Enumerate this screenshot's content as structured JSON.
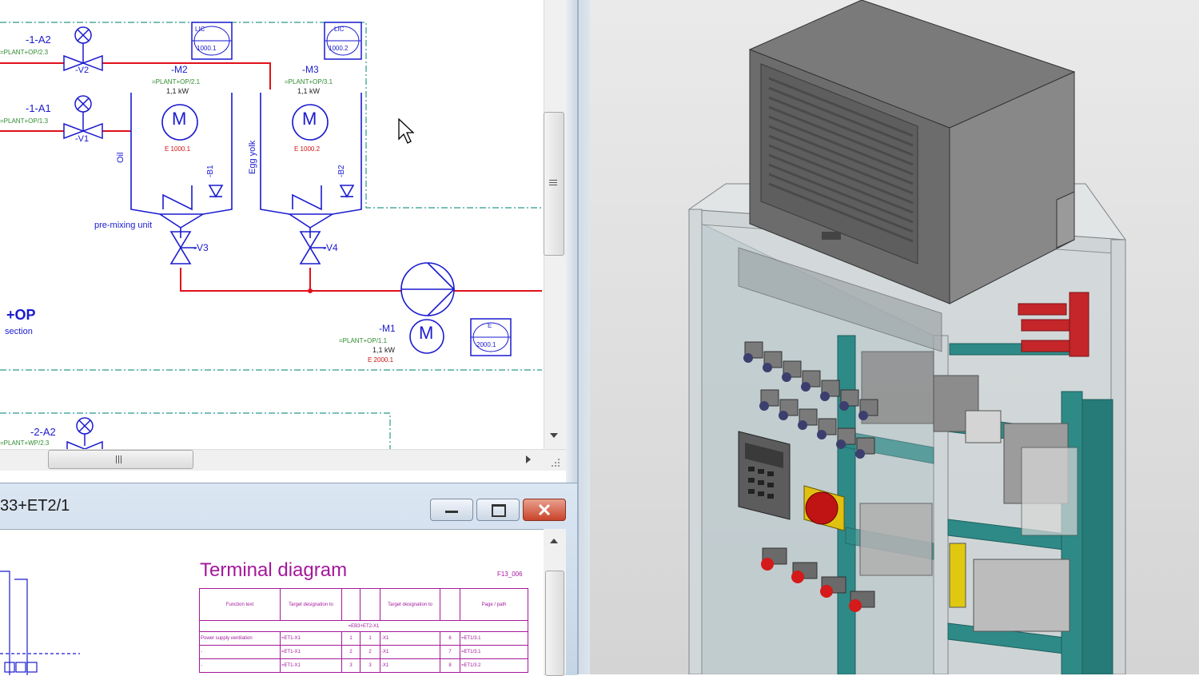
{
  "schematic": {
    "tags": {
      "valve_a2": "-1-A2",
      "valve_a1": "-1-A1",
      "valve_v2": "-V2",
      "valve_v1": "-V1",
      "motor_m2": "-M2",
      "motor_m3": "-M3",
      "valve_v3": "-V3",
      "valve_v4": "-V4",
      "pump_m1": "-M1",
      "valve_2a2": "-2-A2",
      "sensor_b1": "-B1",
      "sensor_b2": "-B2"
    },
    "refs": {
      "a2_ref": "=PLANT+OP/2.3",
      "a1_ref": "=PLANT+OP/1.3",
      "m2_ref": "=PLANT+OP/2.1",
      "m3_ref": "=PLANT+OP/3.1",
      "m1_ref": "=PLANT+OP/1.1",
      "a2b_ref": "=PLANT+WP/2.3"
    },
    "power_m2": "1,1 kW",
    "power_m3": "1,1 kW",
    "power_m1": "1,1 kW",
    "motor_symbol": "M",
    "page_m2": "E 1000.1",
    "page_m3": "E 1000.2",
    "page_m1": "E 2000.1",
    "box_lic1": "LIC",
    "box_lic1_val": "1000.1",
    "box_lic2": "LIC",
    "box_lic2_val": "1000.2",
    "box_e": "E",
    "box_e_val": "2000.1",
    "tank_oil": "Oil",
    "tank_egg": "Egg yolk",
    "pre_mixing": "pre-mixing unit",
    "location": "+OP",
    "location_sub": "section"
  },
  "terminal_window": {
    "title": "33+ET2/1",
    "diagram_title": "Terminal diagram",
    "diagram_ref": "F13_006",
    "headers": [
      "Function text",
      "Target designation to",
      "",
      "",
      "Target designation to",
      "",
      "Page / path"
    ],
    "group_label": "=EB3+ET2-X1",
    "rows": [
      [
        "Power supply ventilation",
        "=ET1-X1",
        "1",
        "1",
        "-X1",
        "6",
        "=ET1/3.1"
      ],
      [
        "-",
        "=ET1-X1",
        "2",
        "2",
        "-X1",
        "7",
        "=ET1/3.1"
      ],
      [
        "-",
        "=ET1-X1",
        "3",
        "3",
        "-X1",
        "8",
        "=ET1/3.2"
      ]
    ]
  },
  "colors": {
    "schematic_blue": "#1a1ad0",
    "pipe_red": "#e0101a",
    "ref_green": "#2e8b2e",
    "terminal_magenta": "#a4189c",
    "cabinet_teal": "#2e8a87"
  },
  "icons": {
    "cursor": "mouse-pointer-icon",
    "minimize": "minimize-icon",
    "maximize": "maximize-icon",
    "close": "close-icon"
  }
}
